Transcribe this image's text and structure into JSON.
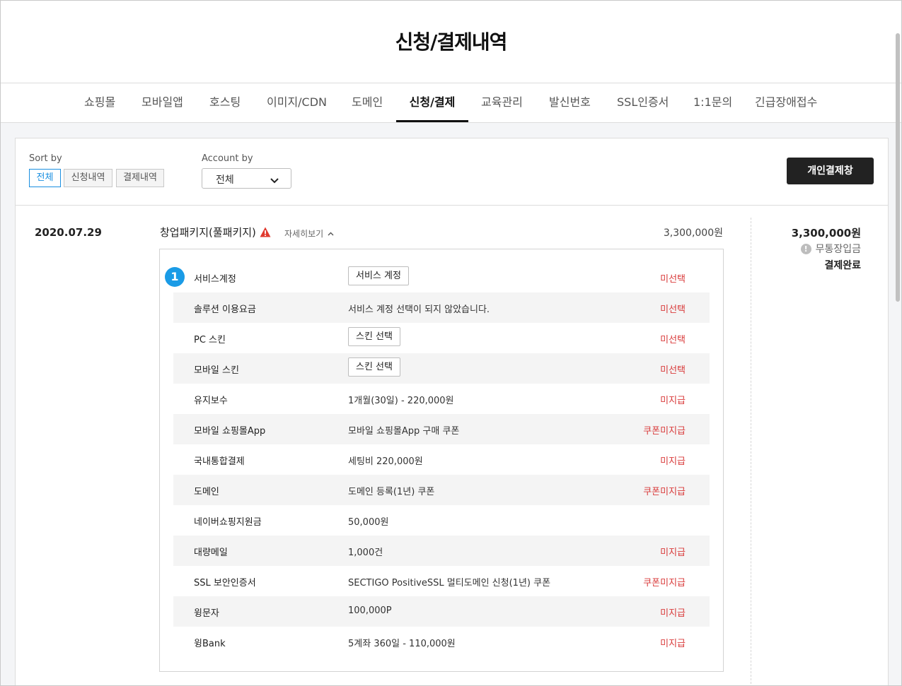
{
  "page": {
    "title": "신청/결제내역"
  },
  "tabs": [
    {
      "label": "쇼핑몰",
      "active": false
    },
    {
      "label": "모바일앱",
      "active": false
    },
    {
      "label": "호스팅",
      "active": false
    },
    {
      "label": "이미지/CDN",
      "active": false
    },
    {
      "label": "도메인",
      "active": false
    },
    {
      "label": "신청/결제",
      "active": true
    },
    {
      "label": "교육관리",
      "active": false
    },
    {
      "label": "발신번호",
      "active": false
    },
    {
      "label": "SSL인증서",
      "active": false
    },
    {
      "label": "1:1문의",
      "active": false
    },
    {
      "label": "긴급장애접수",
      "active": false
    }
  ],
  "filters": {
    "sort_label": "Sort by",
    "sort_options": [
      "전체",
      "신청내역",
      "결제내역"
    ],
    "sort_selected": "전체",
    "account_label": "Account by",
    "account_selected": "전체",
    "pay_button": "개인결제창"
  },
  "order": {
    "date": "2020.07.29",
    "name": "창업패키지(풀패키지)",
    "detail_toggle": "자세히보기",
    "price": "3,300,000원",
    "summary": {
      "amount": "3,300,000원",
      "method": "무통장입금",
      "status": "결제완료"
    },
    "step": "1",
    "items": [
      {
        "label": "서비스계정",
        "value": "서비스 계정",
        "value_type": "button",
        "status": "미선택"
      },
      {
        "label": "솔루션 이용요금",
        "value": "서비스 계정 선택이 되지 않았습니다.",
        "value_type": "text",
        "status": "미선택"
      },
      {
        "label": "PC 스킨",
        "value": "스킨 선택",
        "value_type": "button",
        "status": "미선택"
      },
      {
        "label": "모바일 스킨",
        "value": "스킨 선택",
        "value_type": "button",
        "status": "미선택"
      },
      {
        "label": "유지보수",
        "value": "1개월(30일) - 220,000원",
        "value_type": "text",
        "status": "미지급"
      },
      {
        "label": "모바일 쇼핑몰App",
        "value": "모바일 쇼핑몰App 구매 쿠폰",
        "value_type": "text",
        "status": "쿠폰미지급"
      },
      {
        "label": "국내통합결제",
        "value": "세팅비 220,000원",
        "value_type": "text",
        "status": "미지급"
      },
      {
        "label": "도메인",
        "value": "도메인 등록(1년) 쿠폰",
        "value_type": "text",
        "status": "쿠폰미지급"
      },
      {
        "label": "네이버쇼핑지원금",
        "value": "50,000원",
        "value_type": "text",
        "status": ""
      },
      {
        "label": "대량메일",
        "value": "1,000건",
        "value_type": "text",
        "status": "미지급"
      },
      {
        "label": "SSL 보안인증서",
        "value": "SECTIGO PositiveSSL 멀티도메인 신청(1년) 쿠폰",
        "value_type": "text",
        "status": "쿠폰미지급"
      },
      {
        "label": "윙문자",
        "value": "100,000P",
        "value_type": "text",
        "status": "미지급"
      },
      {
        "label": "윙Bank",
        "value": "5계좌 360일 - 110,000원",
        "value_type": "text",
        "status": "미지급"
      }
    ]
  },
  "colors": {
    "accent": "#1a9be6",
    "status_red": "#d93b3b",
    "dark_button": "#222222",
    "warning": "#e03a2f"
  }
}
